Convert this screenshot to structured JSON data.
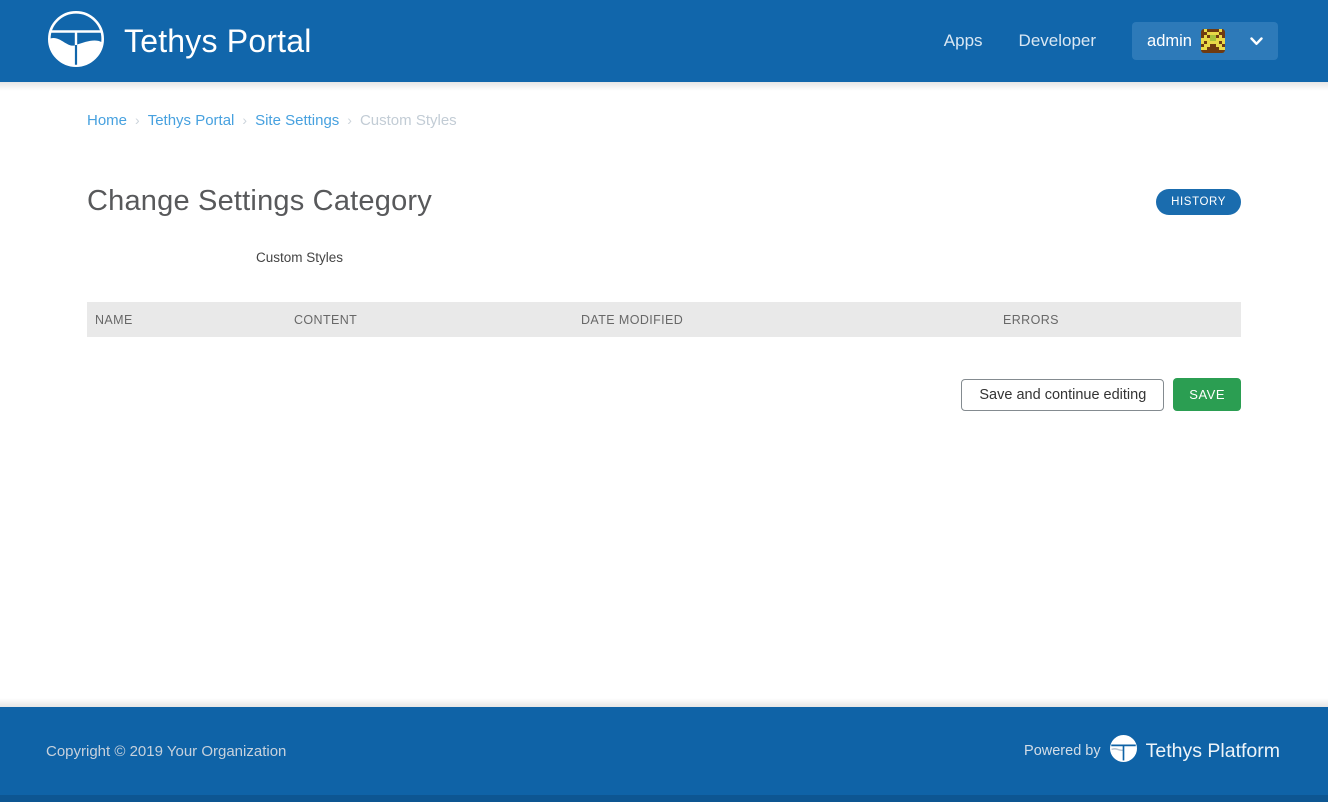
{
  "header": {
    "brand": "Tethys Portal",
    "nav": [
      {
        "label": "Apps"
      },
      {
        "label": "Developer"
      }
    ],
    "user_menu": {
      "username": "admin"
    }
  },
  "breadcrumb": {
    "separator": "›",
    "items": [
      {
        "label": "Home"
      },
      {
        "label": "Tethys Portal"
      },
      {
        "label": "Site Settings"
      },
      {
        "label": "Custom Styles"
      }
    ]
  },
  "main": {
    "page_title": "Change Settings Category",
    "history_button": "HISTORY",
    "category_name": "Custom Styles",
    "table": {
      "columns": [
        "NAME",
        "CONTENT",
        "DATE MODIFIED",
        "ERRORS"
      ],
      "rows": []
    },
    "actions": {
      "save_continue": "Save and continue editing",
      "save": "SAVE"
    }
  },
  "footer": {
    "copyright": "Copyright © 2019 Your Organization",
    "powered_by": "Powered by",
    "platform": "Tethys Platform"
  },
  "colors": {
    "header_blue": "#1166ab",
    "footer_blue": "#0f63a7",
    "accent_blue": "#1a6cae",
    "link_blue": "#47a1df",
    "save_green": "#2b9e52",
    "table_head_gray": "#e9e9e9"
  }
}
